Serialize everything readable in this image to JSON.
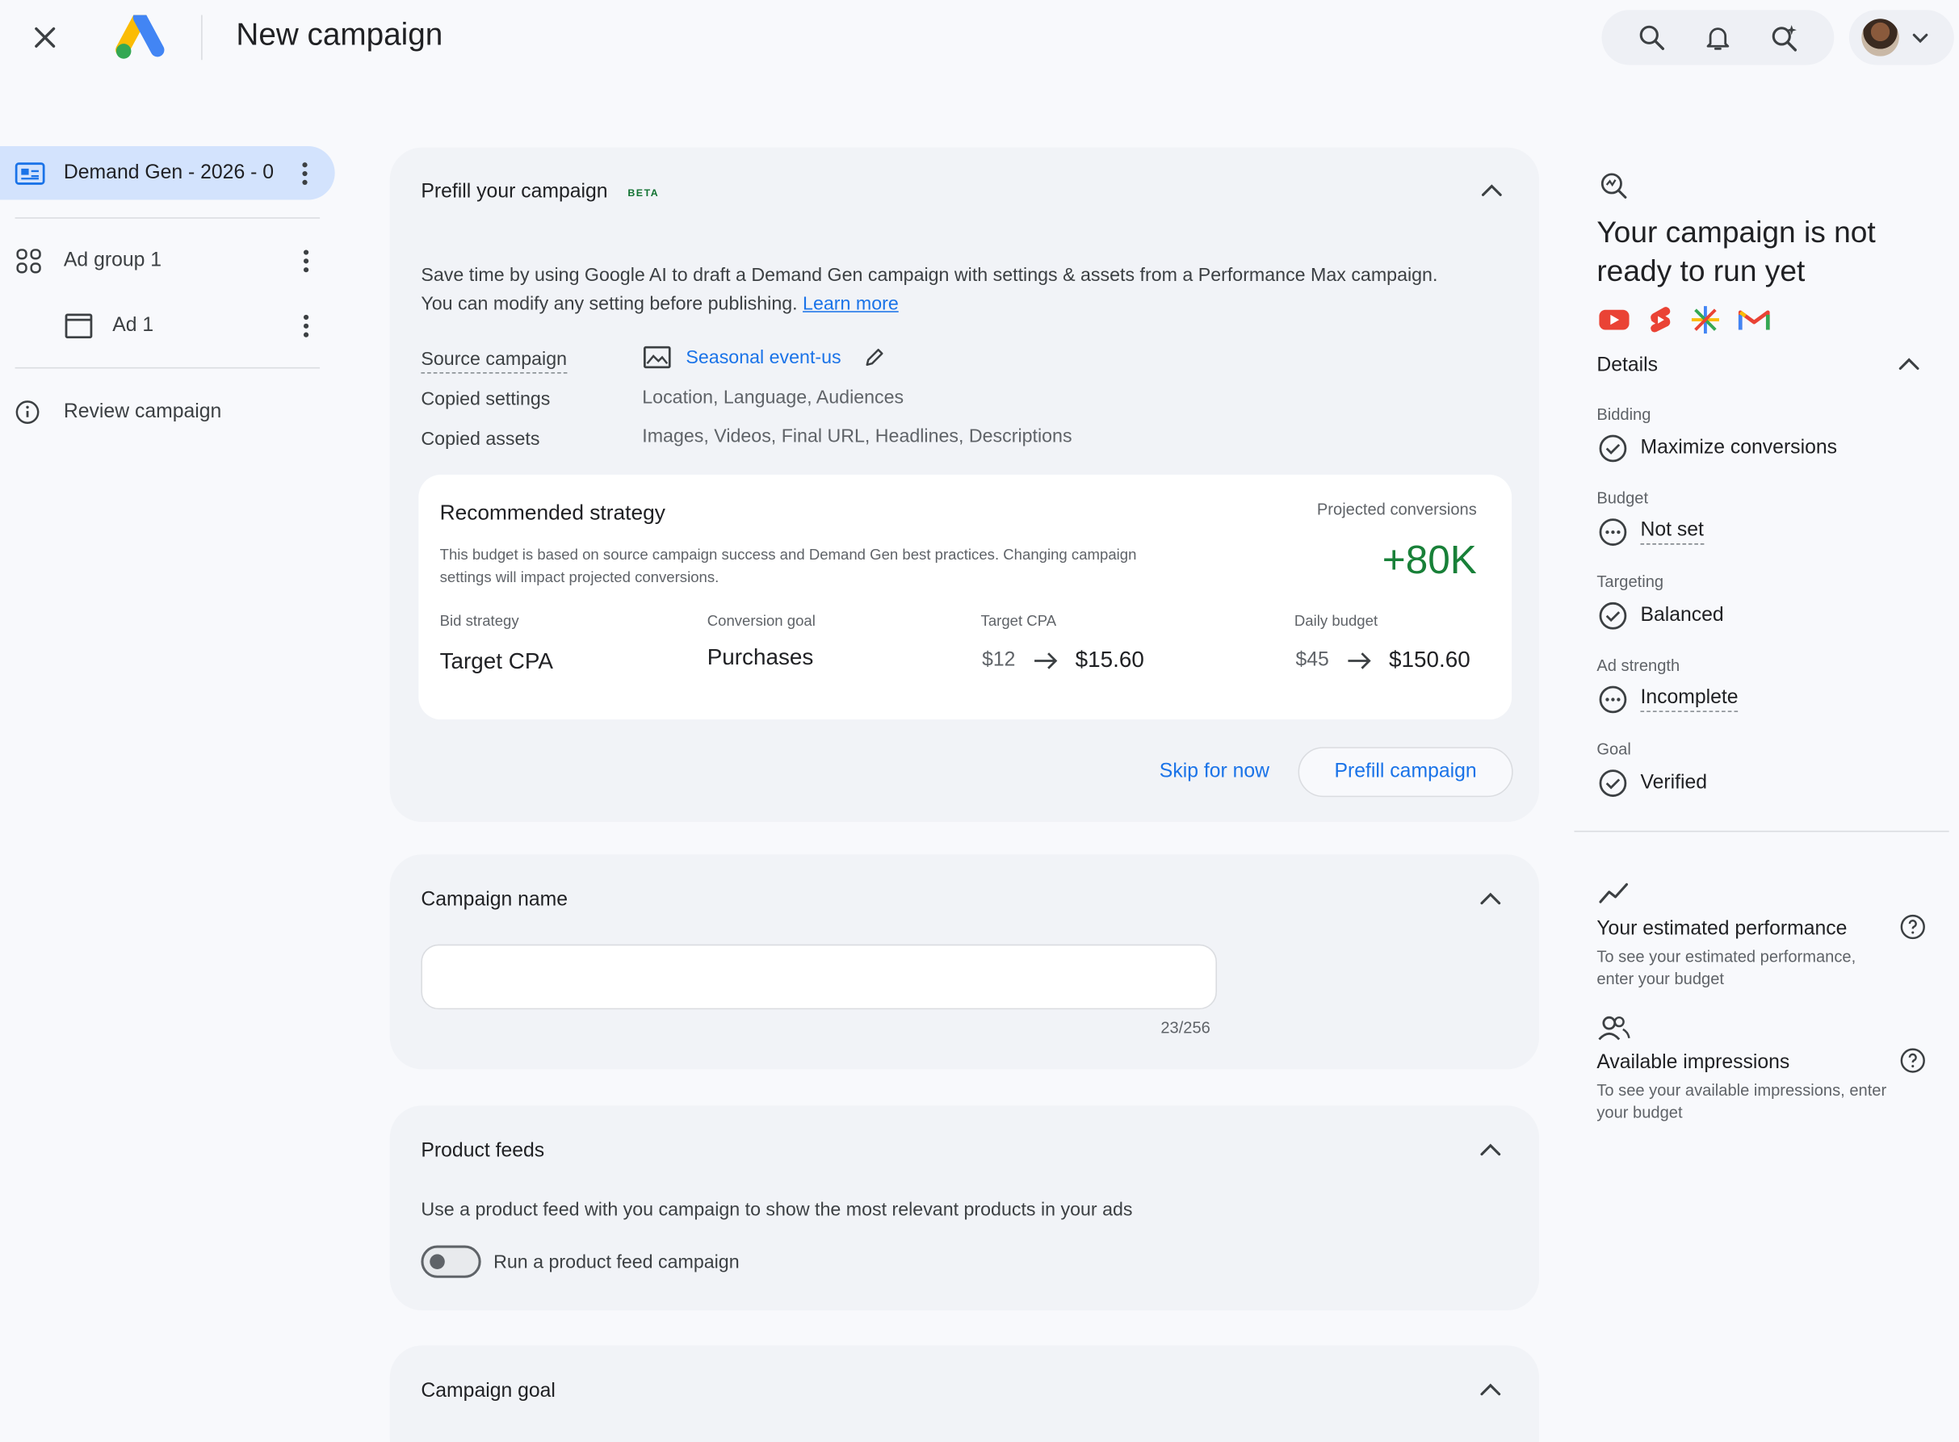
{
  "header": {
    "title": "New campaign"
  },
  "nav": {
    "campaign_label": "Demand Gen - 2026 - 0",
    "ad_group_label": "Ad group 1",
    "ad_label": "Ad 1",
    "review_label": "Review campaign"
  },
  "prefill": {
    "title": "Prefill your campaign",
    "beta": "BETA",
    "description": "Save time by using Google AI to draft a Demand Gen campaign with settings & assets from a Performance Max campaign. You can modify any setting before publishing.",
    "learn_more": "Learn more",
    "source_label": "Source campaign",
    "source_value": "Seasonal event-us",
    "copied_settings_label": "Copied settings",
    "copied_settings_value": "Location, Language, Audiences",
    "copied_assets_label": "Copied assets",
    "copied_assets_value": "Images, Videos, Final URL, Headlines, Descriptions",
    "strategy": {
      "title": "Recommended strategy",
      "description": "This budget is based on source campaign success and Demand Gen best practices. Changing campaign settings will impact projected conversions.",
      "projected_label": "Projected conversions",
      "projected_value": "+80K",
      "bid_label": "Bid strategy",
      "bid_value": "Target CPA",
      "goal_label": "Conversion goal",
      "goal_value": "Purchases",
      "cpa_label": "Target CPA",
      "cpa_old": "$12",
      "cpa_new": "$15.60",
      "budget_label": "Daily budget",
      "budget_old": "$45",
      "budget_new": "$150.60"
    },
    "skip_label": "Skip for now",
    "prefill_label": "Prefill campaign"
  },
  "campaign_name": {
    "title": "Campaign name",
    "value": "",
    "counter": "23/256"
  },
  "product_feeds": {
    "title": "Product feeds",
    "description": "Use a product feed with you campaign to show the most relevant products in your ads",
    "toggle_label": "Run a product feed campaign",
    "toggle_on": false
  },
  "campaign_goal": {
    "title": "Campaign goal"
  },
  "right_panel": {
    "status_title": "Your campaign is not ready to run yet",
    "details_label": "Details",
    "bidding_label": "Bidding",
    "bidding_value": "Maximize conversions",
    "budget_label": "Budget",
    "budget_value": "Not set",
    "targeting_label": "Targeting",
    "targeting_value": "Balanced",
    "ad_strength_label": "Ad strength",
    "ad_strength_value": "Incomplete",
    "goal_label": "Goal",
    "goal_value": "Verified",
    "perf_title": "Your estimated performance",
    "perf_desc": "To see your estimated performance, enter your budget",
    "impr_title": "Available impressions",
    "impr_desc": "To see your available impressions, enter your budget"
  },
  "colors": {
    "accent": "#1a73e8",
    "nav_active": "#d3e3fd",
    "green": "#188038",
    "youtube": "#ea4335",
    "gmail": "#ea4335"
  },
  "icons": [
    "close-icon",
    "google-ads-logo",
    "search-icon",
    "bell-icon",
    "sparkle-search-icon",
    "chevron-down-icon",
    "campaign-icon",
    "ad-group-icon",
    "ad-icon",
    "info-icon",
    "chevron-up-icon",
    "image-icon",
    "pencil-icon",
    "status-search-icon",
    "youtube-icon",
    "shorts-icon",
    "discover-icon",
    "gmail-icon",
    "check-circle-icon",
    "more-circle-icon",
    "trend-icon",
    "help-icon",
    "people-icon"
  ]
}
